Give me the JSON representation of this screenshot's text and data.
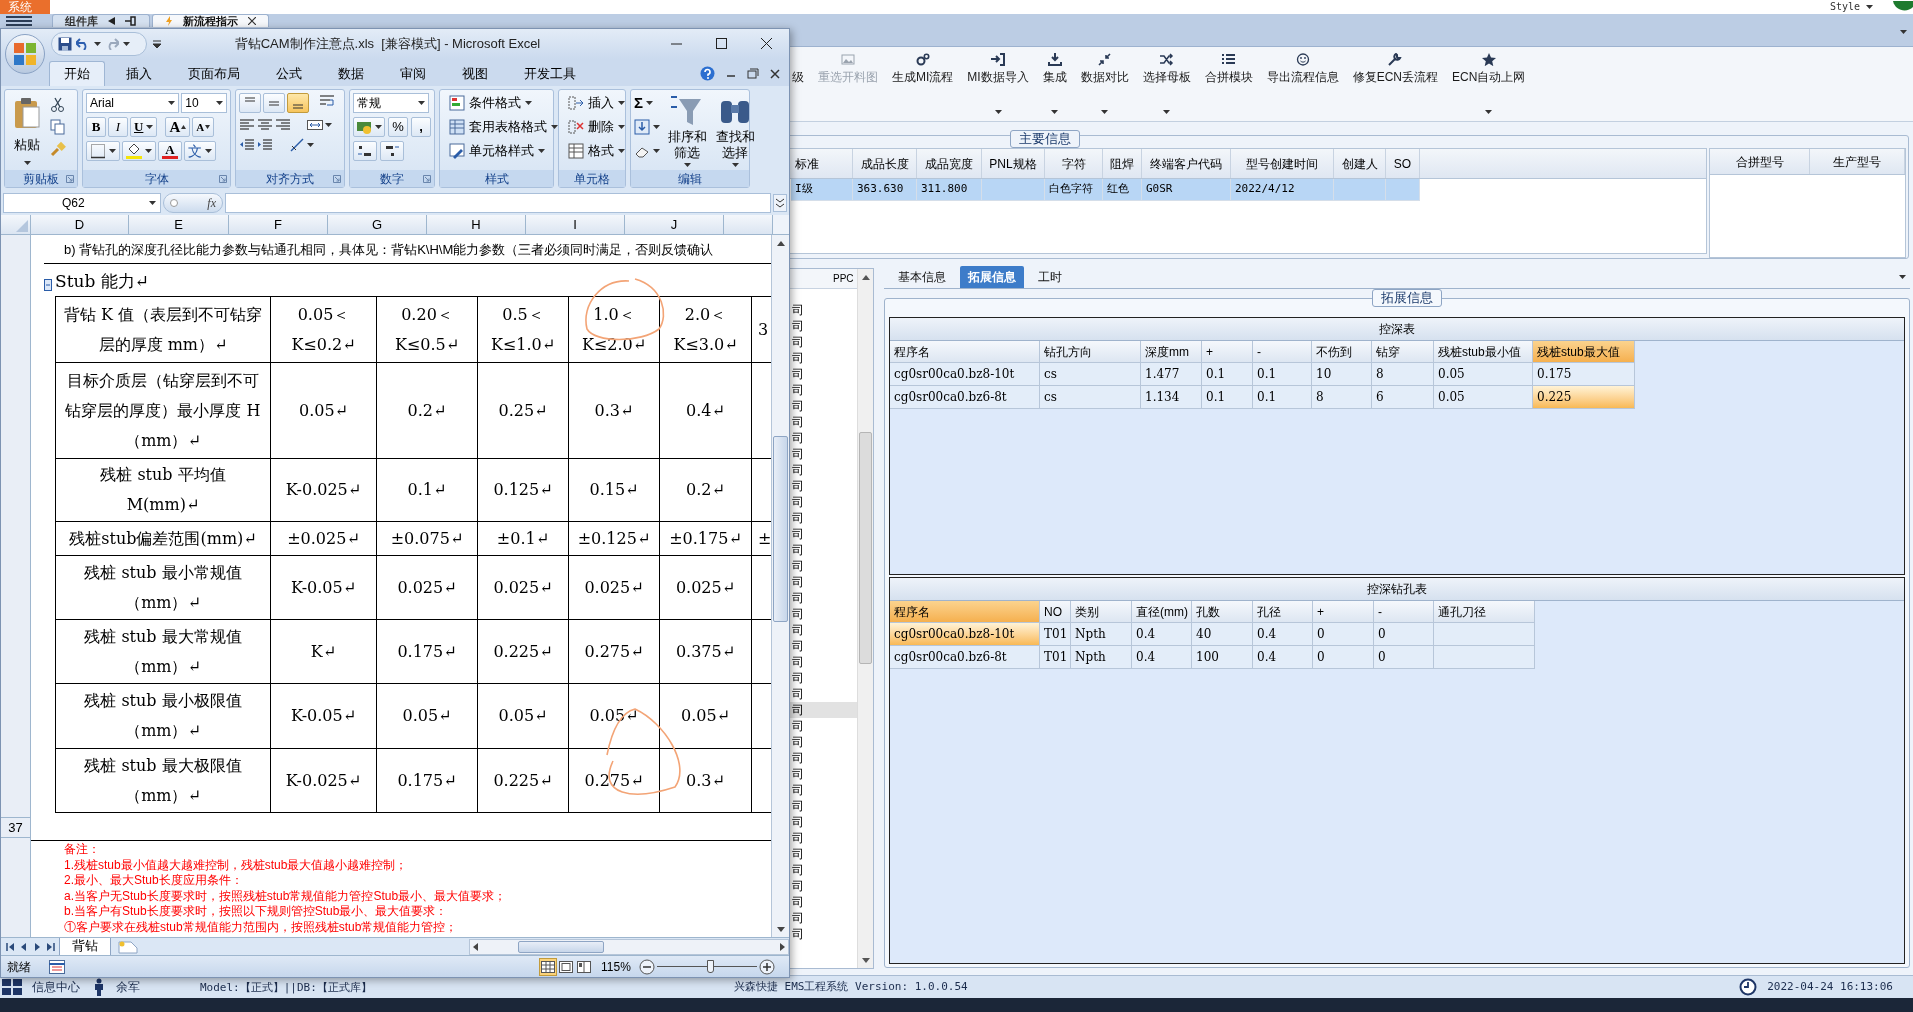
{
  "system_menu": "系统",
  "style_menu": "Style",
  "app_tabs": [
    {
      "label": "组件库",
      "selected": false
    },
    {
      "label": "新流程指示",
      "selected": true
    }
  ],
  "toolbar": [
    {
      "label": "级",
      "disabled": false,
      "dropdown": false
    },
    {
      "label": "重选开料图",
      "disabled": true,
      "dropdown": false
    },
    {
      "label": "生成MI流程",
      "disabled": false,
      "dropdown": false
    },
    {
      "label": "MI数据导入",
      "disabled": false,
      "dropdown": true
    },
    {
      "label": "集成",
      "disabled": false,
      "dropdown": true
    },
    {
      "label": "数据对比",
      "disabled": false,
      "dropdown": true
    },
    {
      "label": "选择母板",
      "disabled": false,
      "dropdown": true
    },
    {
      "label": "合拼模块",
      "disabled": false,
      "dropdown": false
    },
    {
      "label": "导出流程信息",
      "disabled": false,
      "dropdown": false
    },
    {
      "label": "修复ECN丢流程",
      "disabled": false,
      "dropdown": false
    },
    {
      "label": "ECN自动上网",
      "disabled": false,
      "dropdown": true
    }
  ],
  "main_info": {
    "title": "主要信息",
    "columns": [
      "标准",
      "成品长度",
      "成品宽度",
      "PNL规格",
      "字符",
      "阻焊",
      "终端客户代码",
      "型号创建时间",
      "创建人",
      "SO"
    ],
    "rows": [
      {
        "selected": true,
        "cells": [
          "I级",
          "363.630",
          "311.800",
          null,
          "白色字符",
          "红色",
          "G0SR",
          "2022/4/12",
          null,
          null
        ]
      }
    ],
    "merge_columns": [
      "合拼型号",
      "生产型号"
    ]
  },
  "list_pane": {
    "header": "PPC",
    "rows": [
      {
        "text": "司",
        "selected": false
      },
      {
        "text": "司",
        "selected": false
      },
      {
        "text": "司",
        "selected": false
      },
      {
        "text": "司",
        "selected": false
      },
      {
        "text": "司",
        "selected": false
      },
      {
        "text": "司",
        "selected": false
      },
      {
        "text": "司",
        "selected": false
      },
      {
        "text": "司",
        "selected": false
      },
      {
        "text": "司",
        "selected": false
      },
      {
        "text": "司",
        "selected": false
      },
      {
        "text": "司",
        "selected": false
      },
      {
        "text": "司",
        "selected": false
      },
      {
        "text": "司",
        "selected": false
      },
      {
        "text": "司",
        "selected": false
      },
      {
        "text": "司",
        "selected": false
      },
      {
        "text": "司",
        "selected": false
      },
      {
        "text": "司",
        "selected": false
      },
      {
        "text": "司",
        "selected": false
      },
      {
        "text": "司",
        "selected": false
      },
      {
        "text": "司",
        "selected": false
      },
      {
        "text": "司",
        "selected": false
      },
      {
        "text": "司",
        "selected": false
      },
      {
        "text": "司",
        "selected": false
      },
      {
        "text": "司",
        "selected": false
      },
      {
        "text": "司",
        "selected": false
      },
      {
        "text": "司",
        "selected": true
      },
      {
        "text": "司",
        "selected": false
      },
      {
        "text": "司",
        "selected": false
      },
      {
        "text": "司",
        "selected": false
      },
      {
        "text": "司",
        "selected": false
      },
      {
        "text": "司",
        "selected": false
      },
      {
        "text": "司",
        "selected": false
      },
      {
        "text": "司",
        "selected": false
      },
      {
        "text": "司",
        "selected": false
      },
      {
        "text": "司",
        "selected": false
      },
      {
        "text": "司",
        "selected": false
      },
      {
        "text": "司",
        "selected": false
      },
      {
        "text": "司",
        "selected": false
      },
      {
        "text": "司",
        "selected": false
      },
      {
        "text": "司",
        "selected": false
      }
    ]
  },
  "detail_tabs": [
    {
      "label": "基本信息",
      "selected": false
    },
    {
      "label": "拓展信息",
      "selected": true
    },
    {
      "label": "工时",
      "selected": false
    }
  ],
  "extended_info": {
    "title": "拓展信息",
    "depth_table": {
      "title": "控深表",
      "columns": [
        {
          "label": "程序名",
          "focused": false
        },
        {
          "label": "钻孔方向",
          "focused": false
        },
        {
          "label": "深度mm",
          "focused": false
        },
        {
          "label": "+",
          "focused": false
        },
        {
          "label": "-",
          "focused": false
        },
        {
          "label": "不伤到",
          "focused": false
        },
        {
          "label": "钻穿",
          "focused": false
        },
        {
          "label": "残桩stub最小值",
          "focused": false
        },
        {
          "label": "残桩stub最大值",
          "focused": true
        }
      ],
      "rows": [
        {
          "focused": false,
          "cells": [
            "cg0sr00ca0.bz8-10t",
            "cs",
            "1.477",
            "0.1",
            "0.1",
            "10",
            "8",
            "0.05",
            "0.175"
          ]
        },
        {
          "focused": true,
          "cells": [
            "cg0sr00ca0.bz6-8t",
            "cs",
            "1.134",
            "0.1",
            "0.1",
            "8",
            "6",
            "0.05",
            "0.225"
          ]
        }
      ]
    },
    "hole_table": {
      "title": "控深钻孔表",
      "columns": [
        {
          "label": "程序名",
          "focused": true
        },
        {
          "label": "NO",
          "focused": false
        },
        {
          "label": "类别",
          "focused": false
        },
        {
          "label": "直径(mm)",
          "focused": false
        },
        {
          "label": "孔数",
          "focused": false
        },
        {
          "label": "孔径",
          "focused": false
        },
        {
          "label": "+",
          "focused": false
        },
        {
          "label": "-",
          "focused": false
        },
        {
          "label": "通孔刀径",
          "focused": false
        }
      ],
      "rows": [
        {
          "focused": true,
          "cells": [
            "cg0sr00ca0.bz8-10t",
            "T01",
            "Npth",
            "0.4",
            "40",
            "0.4",
            "0",
            "0",
            null
          ]
        },
        {
          "focused": false,
          "cells": [
            "cg0sr00ca0.bz6-8t",
            "T01",
            "Npth",
            "0.4",
            "100",
            "0.4",
            "0",
            "0",
            null
          ]
        }
      ]
    }
  },
  "status_bar": {
    "info_center": "信息中心",
    "user": "余军",
    "environment": "Model:【正式】||DB:【正式库】",
    "app": "兴森快捷 EMS工程系统 Version: 1.0.0.54",
    "datetime": "2022-04-24 16:13:06"
  },
  "excel": {
    "title": "背钻CAM制作注意点.xls  [兼容模式] - Microsoft Excel",
    "ribbon_tabs": [
      {
        "label": "开始",
        "selected": true
      },
      {
        "label": "插入",
        "selected": false
      },
      {
        "label": "页面布局",
        "selected": false
      },
      {
        "label": "公式",
        "selected": false
      },
      {
        "label": "数据",
        "selected": false
      },
      {
        "label": "审阅",
        "selected": false
      },
      {
        "label": "视图",
        "selected": false
      },
      {
        "label": "开发工具",
        "selected": false
      }
    ],
    "clipboard": {
      "paste": "粘贴",
      "group": "剪贴板"
    },
    "font": {
      "name": "Arial",
      "size": "10",
      "bold": "B",
      "italic": "I",
      "underline": "U",
      "grow": "A",
      "shrink": "A",
      "font_color_label": "A",
      "phonetic": "文",
      "group": "字体"
    },
    "alignment": {
      "group": "对齐方式",
      "vertical": [
        {
          "selected": false
        },
        {
          "selected": false
        },
        {
          "selected": true
        }
      ]
    },
    "number": {
      "format": "常规",
      "percent": "%",
      "comma": ",",
      "group": "数字"
    },
    "styles": {
      "buttons": [
        "条件格式",
        "套用表格格式",
        "单元格样式"
      ],
      "group": "样式"
    },
    "cells": {
      "buttons": [
        "插入",
        "删除",
        "格式"
      ],
      "group": "单元格"
    },
    "editing": {
      "sum": "Σ",
      "buttons": [
        "排序和筛选",
        "查找和选择"
      ],
      "group": "编辑"
    },
    "name_box": "Q62",
    "fx": "fx",
    "columns": [
      "D",
      "E",
      "F",
      "G",
      "H",
      "I",
      "J"
    ],
    "intro": "b) 背钻孔的深度孔径比能力参数与钻通孔相同，具体见：背钻K\\H\\M能力参数（三者必须同时满足，否则反馈确认",
    "heading": "Stub 能力↵",
    "table": [
      [
        "背钻 K 值（表层到不可钻穿层的厚度 mm）↵",
        "0.05＜K≤0.2↵",
        "0.20＜K≤0.5↵",
        "0.5＜K≤1.0↵",
        "1.0＜K≤2.0↵",
        "2.0＜K≤3.0↵",
        "3"
      ],
      [
        "目标介质层（钻穿层到不可钻穿层的厚度）最小厚度 H（mm）↵",
        "0.05↵",
        "0.2↵",
        "0.25↵",
        "0.3↵",
        "0.4↵"
      ],
      [
        "残桩 stub 平均值 M(mm)↵",
        "K-0.025↵",
        "0.1↵",
        "0.125↵",
        "0.15↵",
        "0.2↵"
      ],
      [
        "残桩stub偏差范围(mm)↵",
        "±0.025↵",
        "±0.075↵",
        "±0.1↵",
        "±0.125↵",
        "±0.175↵",
        "±"
      ],
      [
        "残桩 stub 最小常规值（mm）↵",
        "K-0.05↵",
        "0.025↵",
        "0.025↵",
        "0.025↵",
        "0.025↵"
      ],
      [
        "残桩 stub 最大常规值（mm）↵",
        "K↵",
        "0.175↵",
        "0.225↵",
        "0.275↵",
        "0.375↵"
      ],
      [
        "残桩 stub 最小极限值（mm）↵",
        "K-0.05↵",
        "0.05↵",
        "0.05↵",
        "0.05↵",
        "0.05↵"
      ],
      [
        "残桩 stub 最大极限值（mm）↵",
        "K-0.025↵",
        "0.175↵",
        "0.225↵",
        "0.275↵",
        "0.3↵"
      ]
    ],
    "row_number": "37",
    "notes": [
      "备注：",
      "1.残桩stub最小值越大越难控制，残桩stub最大值越小越难控制；",
      "2.最小、最大Stub长度应用条件：",
      "a.当客户无Stub长度要求时，按照残桩stub常规值能力管控Stub最小、最大值要求；",
      "b.当客户有Stub长度要求时，按照以下规则管控Stub最小、最大值要求：",
      "①客户要求在残桩stub常规值能力范围内，按照残桩stub常规值能力管控；"
    ],
    "sheet_tabs": [
      {
        "label": "背钻",
        "selected": true
      }
    ],
    "status": "就绪",
    "views": [
      {
        "selected": true
      },
      {
        "selected": false
      },
      {
        "selected": false
      }
    ],
    "zoom": {
      "label": "115%",
      "level": 0.54
    }
  }
}
